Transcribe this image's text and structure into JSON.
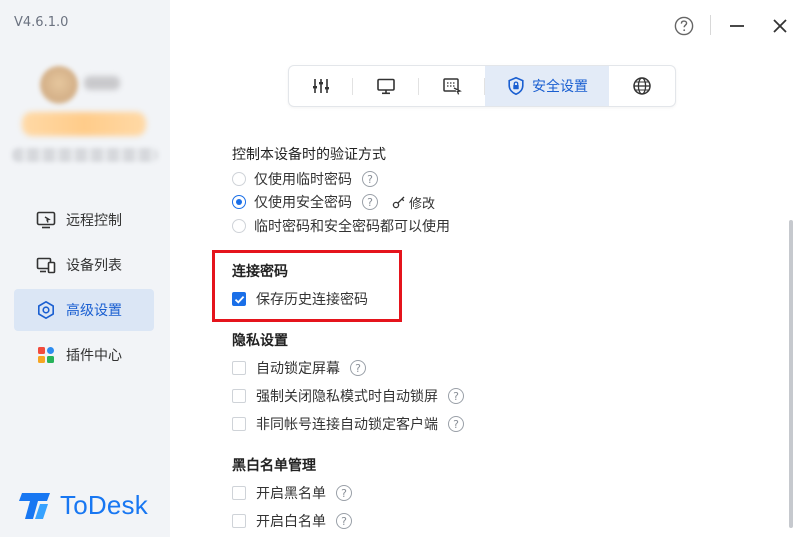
{
  "app": {
    "version": "V4.6.1.0",
    "brand": "ToDesk",
    "brand_color": "#1877f2",
    "accent": "#1a6fe8"
  },
  "sidebar": {
    "items": [
      {
        "label": "远程控制",
        "icon": "remote-control-icon",
        "active": false
      },
      {
        "label": "设备列表",
        "icon": "device-list-icon",
        "active": false
      },
      {
        "label": "高级设置",
        "icon": "advanced-settings-icon",
        "active": true
      },
      {
        "label": "插件中心",
        "icon": "plugin-center-icon",
        "active": false
      }
    ]
  },
  "title_bar": {
    "help_icon": "help-icon",
    "minimize_icon": "minimize-icon",
    "close_icon": "close-icon"
  },
  "tabs": [
    {
      "icon": "sliders-icon",
      "label": ""
    },
    {
      "icon": "monitor-icon",
      "label": ""
    },
    {
      "icon": "screen-select-icon",
      "label": ""
    },
    {
      "icon": "shield-lock-icon",
      "label": "安全设置",
      "active": true
    },
    {
      "icon": "globe-icon",
      "label": ""
    }
  ],
  "verification": {
    "heading": "控制本设备时的验证方式",
    "options": [
      {
        "label": "仅使用临时密码",
        "selected": false,
        "help": true
      },
      {
        "label": "仅使用安全密码",
        "selected": true,
        "help": true,
        "action": "修改"
      },
      {
        "label": "临时密码和安全密码都可以使用",
        "selected": false,
        "help": false
      }
    ]
  },
  "connection_password": {
    "title": "连接密码",
    "save_history": {
      "label": "保存历史连接密码",
      "checked": true
    }
  },
  "privacy": {
    "title": "隐私设置",
    "options": [
      {
        "label": "自动锁定屏幕",
        "checked": false
      },
      {
        "label": "强制关闭隐私模式时自动锁屏",
        "checked": false
      },
      {
        "label": "非同帐号连接自动锁定客户端",
        "checked": false
      }
    ]
  },
  "blacklist": {
    "title": "黑白名单管理",
    "options": [
      {
        "label": "开启黑名单",
        "checked": false
      },
      {
        "label": "开启白名单",
        "checked": false
      }
    ]
  },
  "help_glyph": "?"
}
